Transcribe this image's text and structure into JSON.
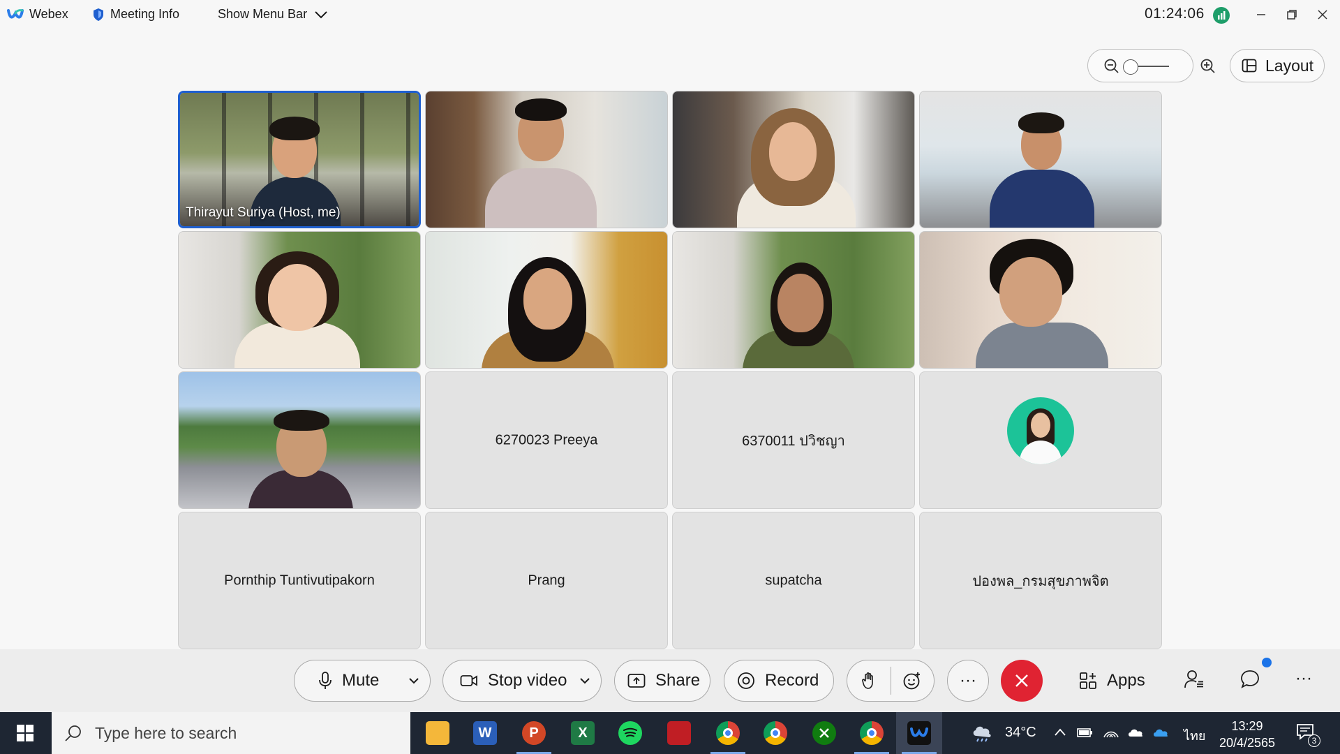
{
  "titlebar": {
    "app_name": "Webex",
    "meeting_info": "Meeting Info",
    "show_menu_bar": "Show Menu Bar",
    "timer": "01:24:06"
  },
  "layout_button": "Layout",
  "participants": [
    {
      "name": "Thirayut Suriya (Host, me)",
      "video": true,
      "active": true
    },
    {
      "name": "",
      "video": true
    },
    {
      "name": "",
      "video": true
    },
    {
      "name": "",
      "video": true
    },
    {
      "name": "",
      "video": true
    },
    {
      "name": "",
      "video": true
    },
    {
      "name": "",
      "video": true
    },
    {
      "name": "",
      "video": true
    },
    {
      "name": "",
      "video": true
    },
    {
      "name": "6270023 Preeya",
      "video": false
    },
    {
      "name": "6370011 ปวิชญา",
      "video": false
    },
    {
      "name": "",
      "video": false,
      "avatar": true
    },
    {
      "name": "Pornthip Tuntivutipakorn",
      "video": false
    },
    {
      "name": "Prang",
      "video": false
    },
    {
      "name": "supatcha",
      "video": false
    },
    {
      "name": "ปองพล_กรมสุขภาพจิต",
      "video": false
    }
  ],
  "toolbar": {
    "mute": "Mute",
    "stop_video": "Stop video",
    "share": "Share",
    "record": "Record",
    "more": "···",
    "apps": "Apps",
    "overflow": "···"
  },
  "taskbar": {
    "search_placeholder": "Type here to search",
    "temperature": "34°C",
    "language": "ไทย",
    "time": "13:29",
    "date": "20/4/2565",
    "notification_count": "3"
  },
  "colors": {
    "accent_active_tile": "#1f5fcf",
    "leave_button": "#e02332",
    "taskbar": "#1e2633"
  }
}
